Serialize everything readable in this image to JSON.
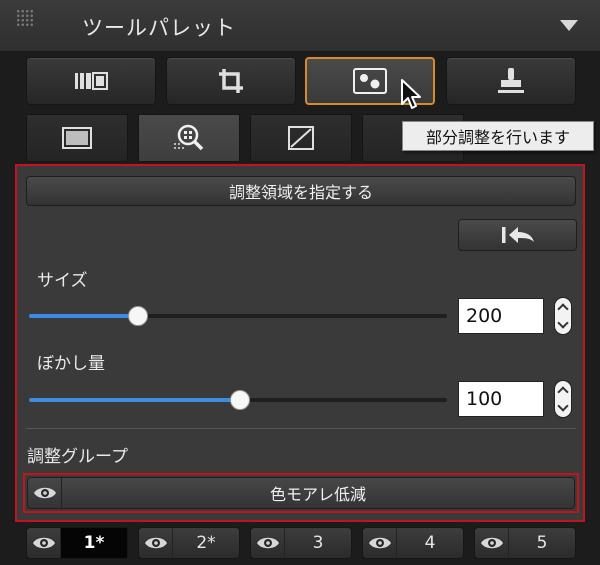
{
  "window": {
    "title": "ツールパレット"
  },
  "toolbar": {
    "icons": [
      "basic-adjust-icon",
      "crop-icon",
      "partial-adjust-icon",
      "stamp-icon"
    ],
    "active_index": 2
  },
  "tabs": {
    "icons": [
      "frame-icon",
      "detail-zoom-icon",
      "curve-icon",
      "color-icon"
    ],
    "active_index": 1
  },
  "tooltip": {
    "text": "部分調整を行います"
  },
  "panel": {
    "specify_area_button": "調整領域を指定する",
    "size": {
      "label": "サイズ",
      "value": "200",
      "fraction": 0.26
    },
    "feather": {
      "label": "ぼかし量",
      "value": "100",
      "fraction": 0.505
    },
    "adjust_group_label": "調整グループ",
    "group_item": "色モアレ低減"
  },
  "pages": [
    {
      "label": "1*",
      "active": true
    },
    {
      "label": "2*",
      "active": false
    },
    {
      "label": "3",
      "active": false
    },
    {
      "label": "4",
      "active": false
    },
    {
      "label": "5",
      "active": false
    }
  ],
  "colors": {
    "accent_orange": "#d98a28",
    "highlight_red": "#c1141c",
    "slider_blue": "#3d8be4"
  }
}
